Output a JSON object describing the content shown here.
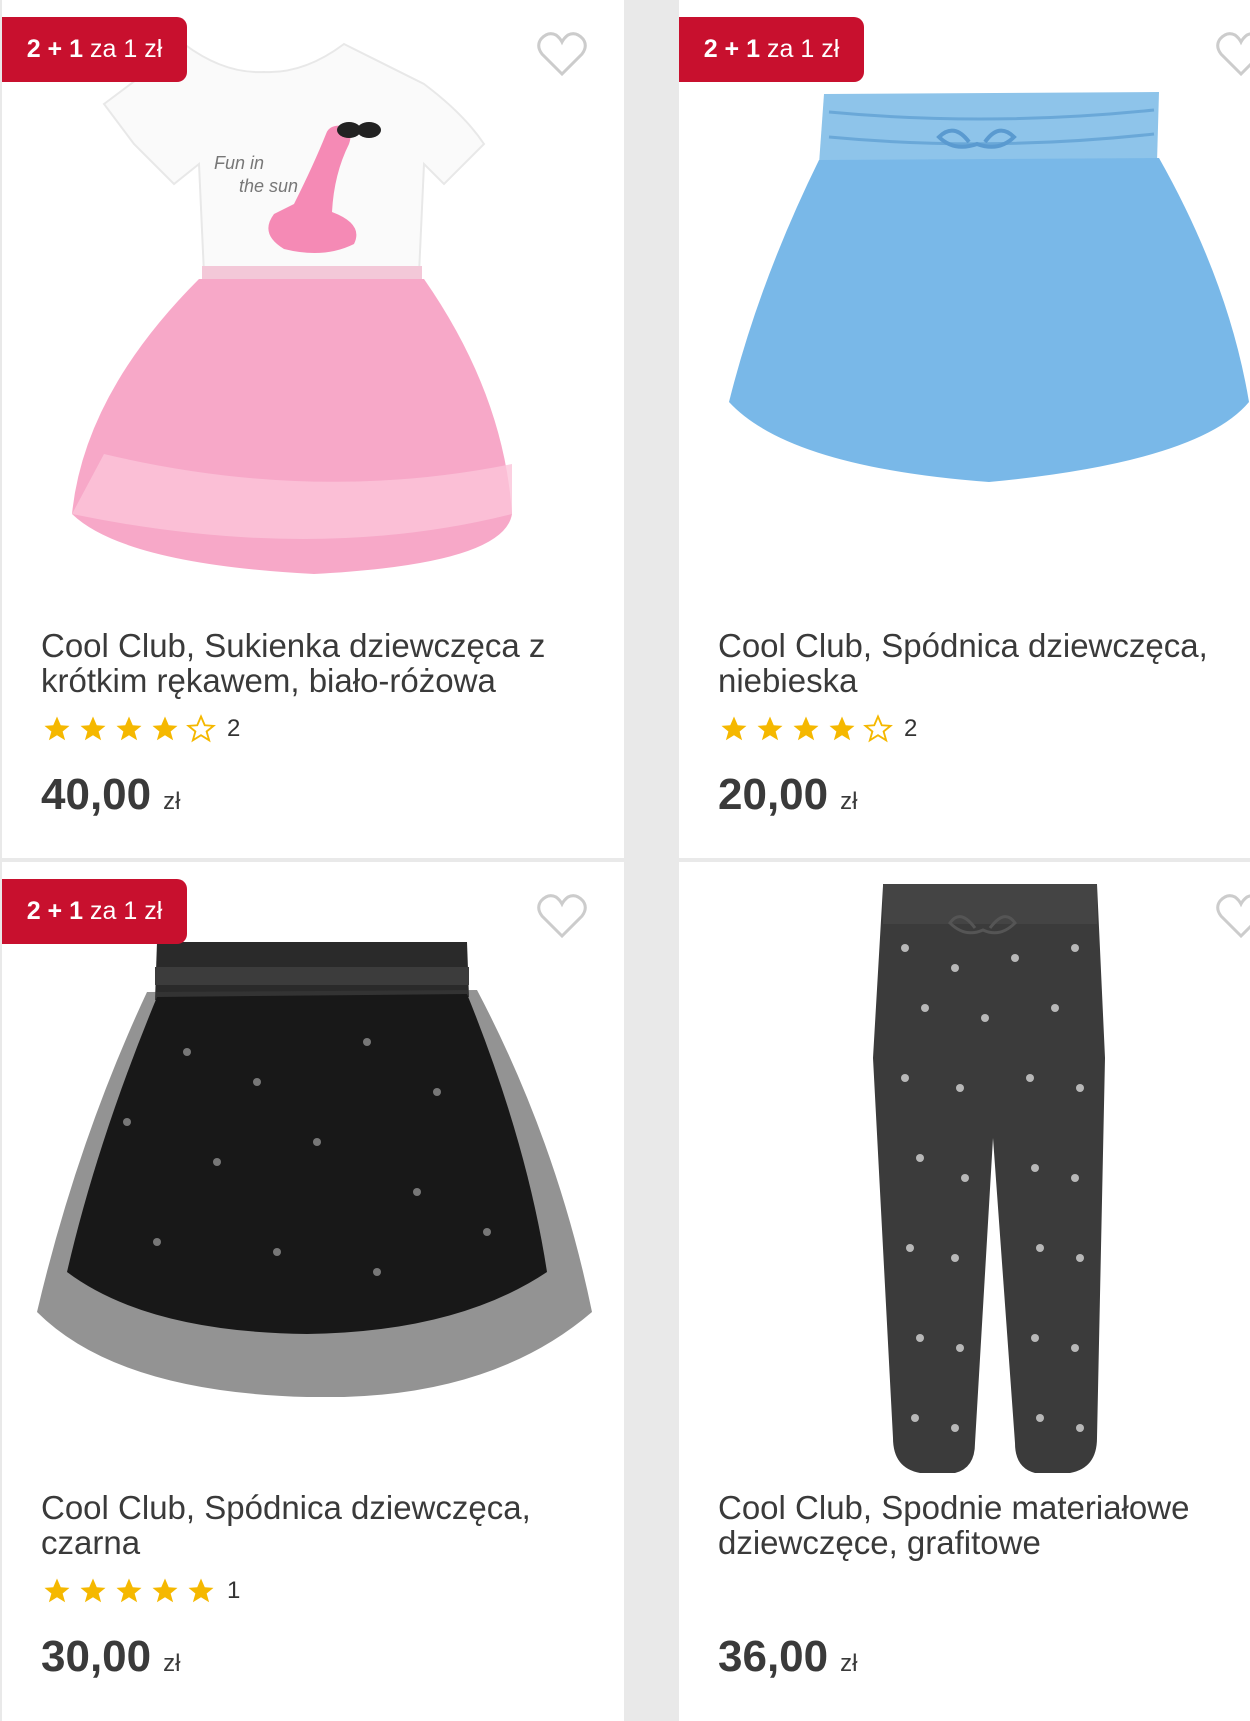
{
  "currency": "zł",
  "badge": {
    "bold": "2 + 1",
    "rest": "za 1 zł"
  },
  "products": [
    {
      "title": "Cool Club, Sukienka dziewczęca z krótkim rękawem, biało-różowa",
      "rating": 4,
      "reviews": "2",
      "price": "40,00",
      "promo": true
    },
    {
      "title": "Cool Club, Spódnica dziewczęca, niebieska",
      "rating": 4,
      "reviews": "2",
      "price": "20,00",
      "promo": true
    },
    {
      "title": "Cool Club, Spódnica dziewczęca, czarna",
      "rating": 5,
      "reviews": "1",
      "price": "30,00",
      "promo": true
    },
    {
      "title": "Cool Club, Spodnie materiałowe dziewczęce, grafitowe",
      "rating": null,
      "reviews": "",
      "price": "36,00",
      "promo": false
    }
  ],
  "colors": {
    "badge": "#c8102e",
    "star": "#f5b800"
  }
}
